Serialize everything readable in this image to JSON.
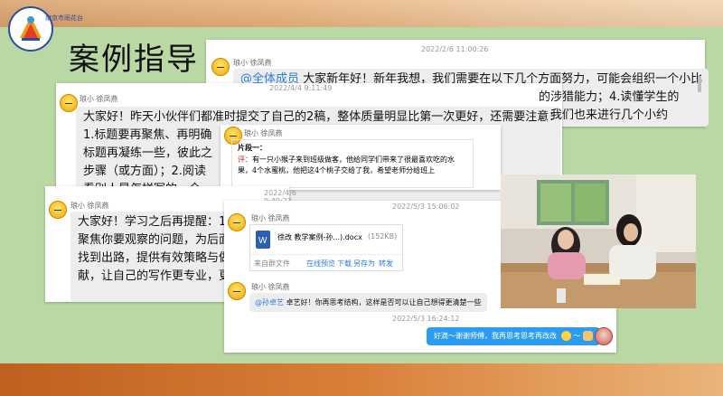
{
  "logo": {
    "text": "南京市雨花台区梅山小学"
  },
  "title": "案例指导",
  "panel_a": {
    "timestamp": "2022/2/6 11:00:26",
    "name": "琅小  徐凤燕",
    "mention": "@全体成员",
    "line1": " 大家新年好！新年我想，我们需要在以下几个方面努力，可能会组织一个小比",
    "line2": "的涉猎能力；4.读懂学生的",
    "line3": "。我们也来进行几个小约"
  },
  "panel_b": {
    "timestamp": "2022/4/4 9:11:49",
    "name": "琅小  徐凤燕",
    "line1": "大家好！昨天小伙伴们都准时提交了自己的2稿，整体质量明显比第一次更好，还需要注意：",
    "line2": "1.标题要再聚焦、再明确",
    "line3": "标题再凝练一些，彼此之",
    "line4": "步骤（或方面）；2.阅读",
    "line5": "看别人是怎样写的，全"
  },
  "panel_c": {
    "name": "琅小  徐凤燕",
    "heading": "片段一：",
    "prefix": "评：",
    "body": "有一只小猴子来到班级做客，他给同学们带来了很最喜欢吃的水果，4个水蜜桃，他把这4个桃子交给了我，希望老师分给班上"
  },
  "panel_d": {
    "timestamp": "2022/4/6 9:49:23",
    "name": "琅小  徐凤燕",
    "line1": "大家好！学习之后再提醒：1.案",
    "line2": "聚焦你要观察的问题，为后面的",
    "line3": "找到出路，提供有效策略与做法",
    "line4": "献，让自己的写作更专业，更学"
  },
  "panel_e": {
    "timestamp1": "2022/5/3 15:06:02",
    "name1": "琅小  徐凤燕",
    "file_name": "徐改  教学案例-孙...).docx",
    "file_size": "(152KB)",
    "file_source": "来自群文件",
    "file_actions": [
      "在线预览",
      "下载",
      "另存为",
      "转发"
    ],
    "name2": "琅小  徐凤燕",
    "mention": "@孙卓艺",
    "reply": " 卓艺好！你再思考结构，这样是否可以让自己想得更清楚一些",
    "timestamp2": "2022/5/3 16:24:12",
    "self_msg": "好滴～谢谢师傅，我再思考思考再改改"
  },
  "colors": {
    "accent": "#2b7de0",
    "self_bubble": "#2c9cf2"
  }
}
